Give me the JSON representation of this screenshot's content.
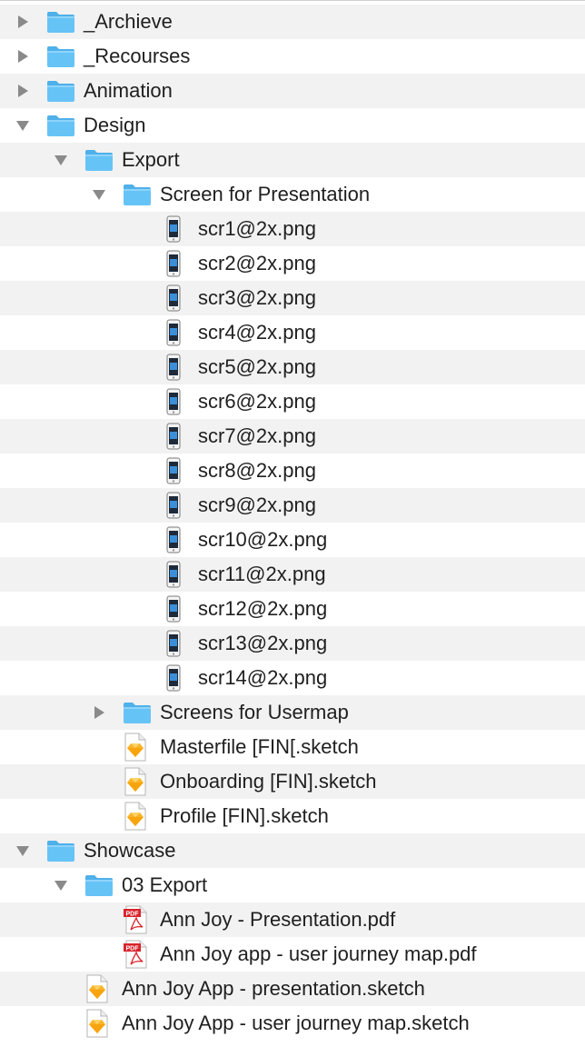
{
  "colors": {
    "folder_body": "#66c3f6",
    "folder_tab": "#4fb0ea",
    "disclosure": "#8a8a8a",
    "row_alt": "#f2f2f2",
    "pdf_red": "#d9232b",
    "sketch_gold": "#f9b52a"
  },
  "items": [
    {
      "label": "_Archieve",
      "kind": "folder",
      "depth": 0,
      "state": "collapsed",
      "icon": "folder-icon"
    },
    {
      "label": "_Recourses",
      "kind": "folder",
      "depth": 0,
      "state": "collapsed",
      "icon": "folder-icon"
    },
    {
      "label": "Animation",
      "kind": "folder",
      "depth": 0,
      "state": "collapsed",
      "icon": "folder-icon"
    },
    {
      "label": "Design",
      "kind": "folder",
      "depth": 0,
      "state": "expanded",
      "icon": "folder-icon"
    },
    {
      "label": "Export",
      "kind": "folder",
      "depth": 1,
      "state": "expanded",
      "icon": "folder-icon"
    },
    {
      "label": "Screen for Presentation",
      "kind": "folder",
      "depth": 2,
      "state": "expanded",
      "icon": "folder-icon"
    },
    {
      "label": "scr1@2x.png",
      "kind": "png",
      "depth": 3,
      "icon": "phone-image-icon"
    },
    {
      "label": "scr2@2x.png",
      "kind": "png",
      "depth": 3,
      "icon": "phone-image-icon"
    },
    {
      "label": "scr3@2x.png",
      "kind": "png",
      "depth": 3,
      "icon": "phone-image-icon"
    },
    {
      "label": "scr4@2x.png",
      "kind": "png",
      "depth": 3,
      "icon": "phone-image-icon"
    },
    {
      "label": "scr5@2x.png",
      "kind": "png",
      "depth": 3,
      "icon": "phone-image-icon"
    },
    {
      "label": "scr6@2x.png",
      "kind": "png",
      "depth": 3,
      "icon": "phone-image-icon"
    },
    {
      "label": "scr7@2x.png",
      "kind": "png",
      "depth": 3,
      "icon": "phone-image-icon"
    },
    {
      "label": "scr8@2x.png",
      "kind": "png",
      "depth": 3,
      "icon": "phone-image-icon"
    },
    {
      "label": "scr9@2x.png",
      "kind": "png",
      "depth": 3,
      "icon": "phone-image-icon"
    },
    {
      "label": "scr10@2x.png",
      "kind": "png",
      "depth": 3,
      "icon": "phone-image-icon"
    },
    {
      "label": "scr11@2x.png",
      "kind": "png",
      "depth": 3,
      "icon": "phone-image-icon"
    },
    {
      "label": "scr12@2x.png",
      "kind": "png",
      "depth": 3,
      "icon": "phone-image-icon"
    },
    {
      "label": "scr13@2x.png",
      "kind": "png",
      "depth": 3,
      "icon": "phone-image-icon"
    },
    {
      "label": "scr14@2x.png",
      "kind": "png",
      "depth": 3,
      "icon": "phone-image-icon"
    },
    {
      "label": "Screens for Usermap",
      "kind": "folder",
      "depth": 2,
      "state": "collapsed",
      "icon": "folder-icon"
    },
    {
      "label": "Masterfile [FIN[.sketch",
      "kind": "sketch",
      "depth": 2,
      "icon": "sketch-file-icon"
    },
    {
      "label": "Onboarding [FIN].sketch",
      "kind": "sketch",
      "depth": 2,
      "icon": "sketch-file-icon"
    },
    {
      "label": "Profile [FIN].sketch",
      "kind": "sketch",
      "depth": 2,
      "icon": "sketch-file-icon"
    },
    {
      "label": "Showcase",
      "kind": "folder",
      "depth": 0,
      "state": "expanded",
      "icon": "folder-icon"
    },
    {
      "label": "03 Export",
      "kind": "folder",
      "depth": 1,
      "state": "expanded",
      "icon": "folder-icon"
    },
    {
      "label": "Ann Joy - Presentation.pdf",
      "kind": "pdf",
      "depth": 2,
      "icon": "pdf-file-icon"
    },
    {
      "label": "Ann Joy app - user journey map.pdf",
      "kind": "pdf",
      "depth": 2,
      "icon": "pdf-file-icon"
    },
    {
      "label": "Ann Joy App - presentation.sketch",
      "kind": "sketch",
      "depth": 1,
      "icon": "sketch-file-icon"
    },
    {
      "label": "Ann Joy App - user journey map.sketch",
      "kind": "sketch",
      "depth": 1,
      "icon": "sketch-file-icon"
    }
  ]
}
